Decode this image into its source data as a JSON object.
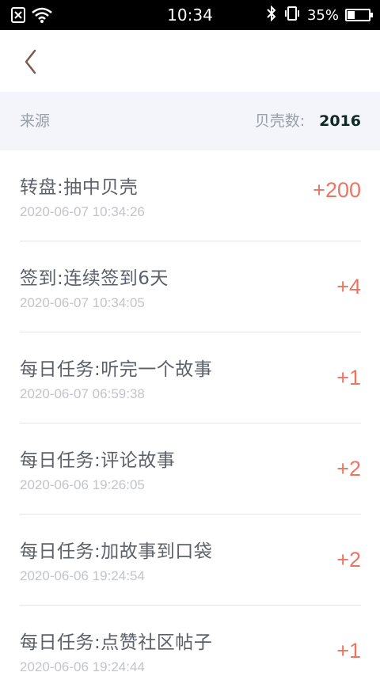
{
  "status_bar": {
    "time": "10:34",
    "battery_percent": "35%",
    "battery_level": 0.35,
    "icons": [
      "sim-error-icon",
      "wifi-icon",
      "bluetooth-icon",
      "vibrate-icon",
      "battery-icon"
    ]
  },
  "nav": {
    "back_icon": "chevron-left-icon"
  },
  "summary": {
    "source_label": "来源",
    "count_label": "贝壳数:",
    "count_value": "2016"
  },
  "items": [
    {
      "title": "转盘:抽中贝壳",
      "time": "2020-06-07 10:34:26",
      "points": "+200"
    },
    {
      "title": "签到:连续签到6天",
      "time": "2020-06-07 10:34:05",
      "points": "+4"
    },
    {
      "title": "每日任务:听完一个故事",
      "time": "2020-06-07 06:59:38",
      "points": "+1"
    },
    {
      "title": "每日任务:评论故事",
      "time": "2020-06-06 19:26:05",
      "points": "+2"
    },
    {
      "title": "每日任务:加故事到口袋",
      "time": "2020-06-06 19:24:54",
      "points": "+2"
    },
    {
      "title": "每日任务:点赞社区帖子",
      "time": "2020-06-06 19:24:44",
      "points": "+1"
    }
  ],
  "colors": {
    "accent": "#ec7562",
    "summary_bg": "#f3f5fb",
    "title_text": "#5c6068",
    "time_text": "#c2c4c8",
    "count_text": "#0f2a26"
  }
}
